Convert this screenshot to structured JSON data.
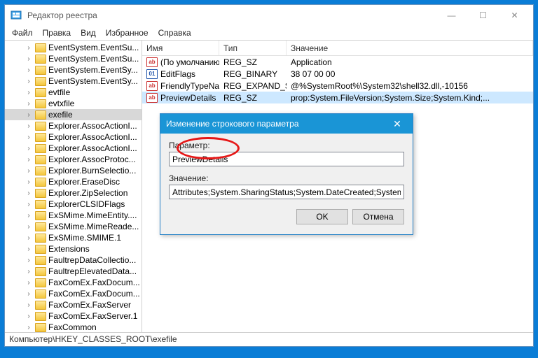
{
  "window": {
    "title": "Редактор реестра"
  },
  "menu": {
    "file": "Файл",
    "edit": "Правка",
    "view": "Вид",
    "favorites": "Избранное",
    "help": "Справка"
  },
  "tree": {
    "items": [
      "EventSystem.EventSu...",
      "EventSystem.EventSu...",
      "EventSystem.EventSy...",
      "EventSystem.EventSy...",
      "evtfile",
      "evtxfile",
      "exefile",
      "Explorer.AssocActionI...",
      "Explorer.AssocActionI...",
      "Explorer.AssocActionI...",
      "Explorer.AssocProtoc...",
      "Explorer.BurnSelectio...",
      "Explorer.EraseDisc",
      "Explorer.ZipSelection",
      "ExplorerCLSIDFlags",
      "ExSMime.MimeEntity....",
      "ExSMime.MimeReade...",
      "ExSMime.SMIME.1",
      "Extensions",
      "FaultrepDataCollectio...",
      "FaultrepElevatedData...",
      "FaxComEx.FaxDocum...",
      "FaxComEx.FaxDocum...",
      "FaxComEx.FaxServer",
      "FaxComEx.FaxServer.1",
      "FaxCommon"
    ],
    "selected_index": 6
  },
  "list": {
    "headers": {
      "name": "Имя",
      "type": "Тип",
      "value": "Значение"
    },
    "rows": [
      {
        "icon": "str",
        "name": "(По умолчанию)",
        "type": "REG_SZ",
        "value": "Application"
      },
      {
        "icon": "bin",
        "name": "EditFlags",
        "type": "REG_BINARY",
        "value": "38 07 00 00"
      },
      {
        "icon": "str",
        "name": "FriendlyTypeNa...",
        "type": "REG_EXPAND_SZ",
        "value": "@%SystemRoot%\\System32\\shell32.dll,-10156"
      },
      {
        "icon": "str",
        "name": "PreviewDetails",
        "type": "REG_SZ",
        "value": "prop:System.FileVersion;System.Size;System.Kind;..."
      }
    ],
    "selected_index": 3
  },
  "dialog": {
    "title": "Изменение строкового параметра",
    "param_label": "Параметр:",
    "param_value": "PreviewDetails",
    "value_label": "Значение:",
    "value_value": "Attributes;System.SharingStatus;System.DateCreated;System.DateModified",
    "ok": "OK",
    "cancel": "Отмена"
  },
  "status": {
    "path": "Компьютер\\HKEY_CLASSES_ROOT\\exefile"
  }
}
